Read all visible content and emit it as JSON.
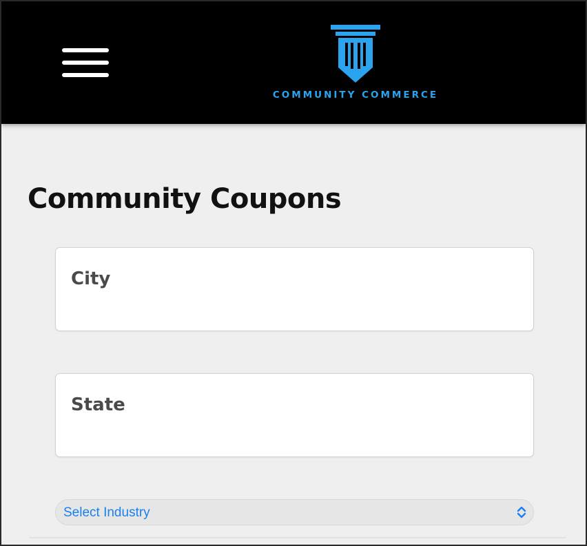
{
  "header": {
    "menu_icon": "hamburger-menu-icon",
    "logo_icon": "pillar-shield-icon",
    "brand_text": "COMMUNITY COMMERCE",
    "background_color": "#000000",
    "brand_color": "#2BA3EE"
  },
  "main": {
    "title": "Community Coupons",
    "city": {
      "placeholder": "City",
      "value": ""
    },
    "state": {
      "placeholder": "State",
      "value": ""
    },
    "industry_select": {
      "selected_label": "Select Industry",
      "chevron_icon": "up-down-chevron-icon",
      "accent_color": "#1A7FF0"
    }
  }
}
